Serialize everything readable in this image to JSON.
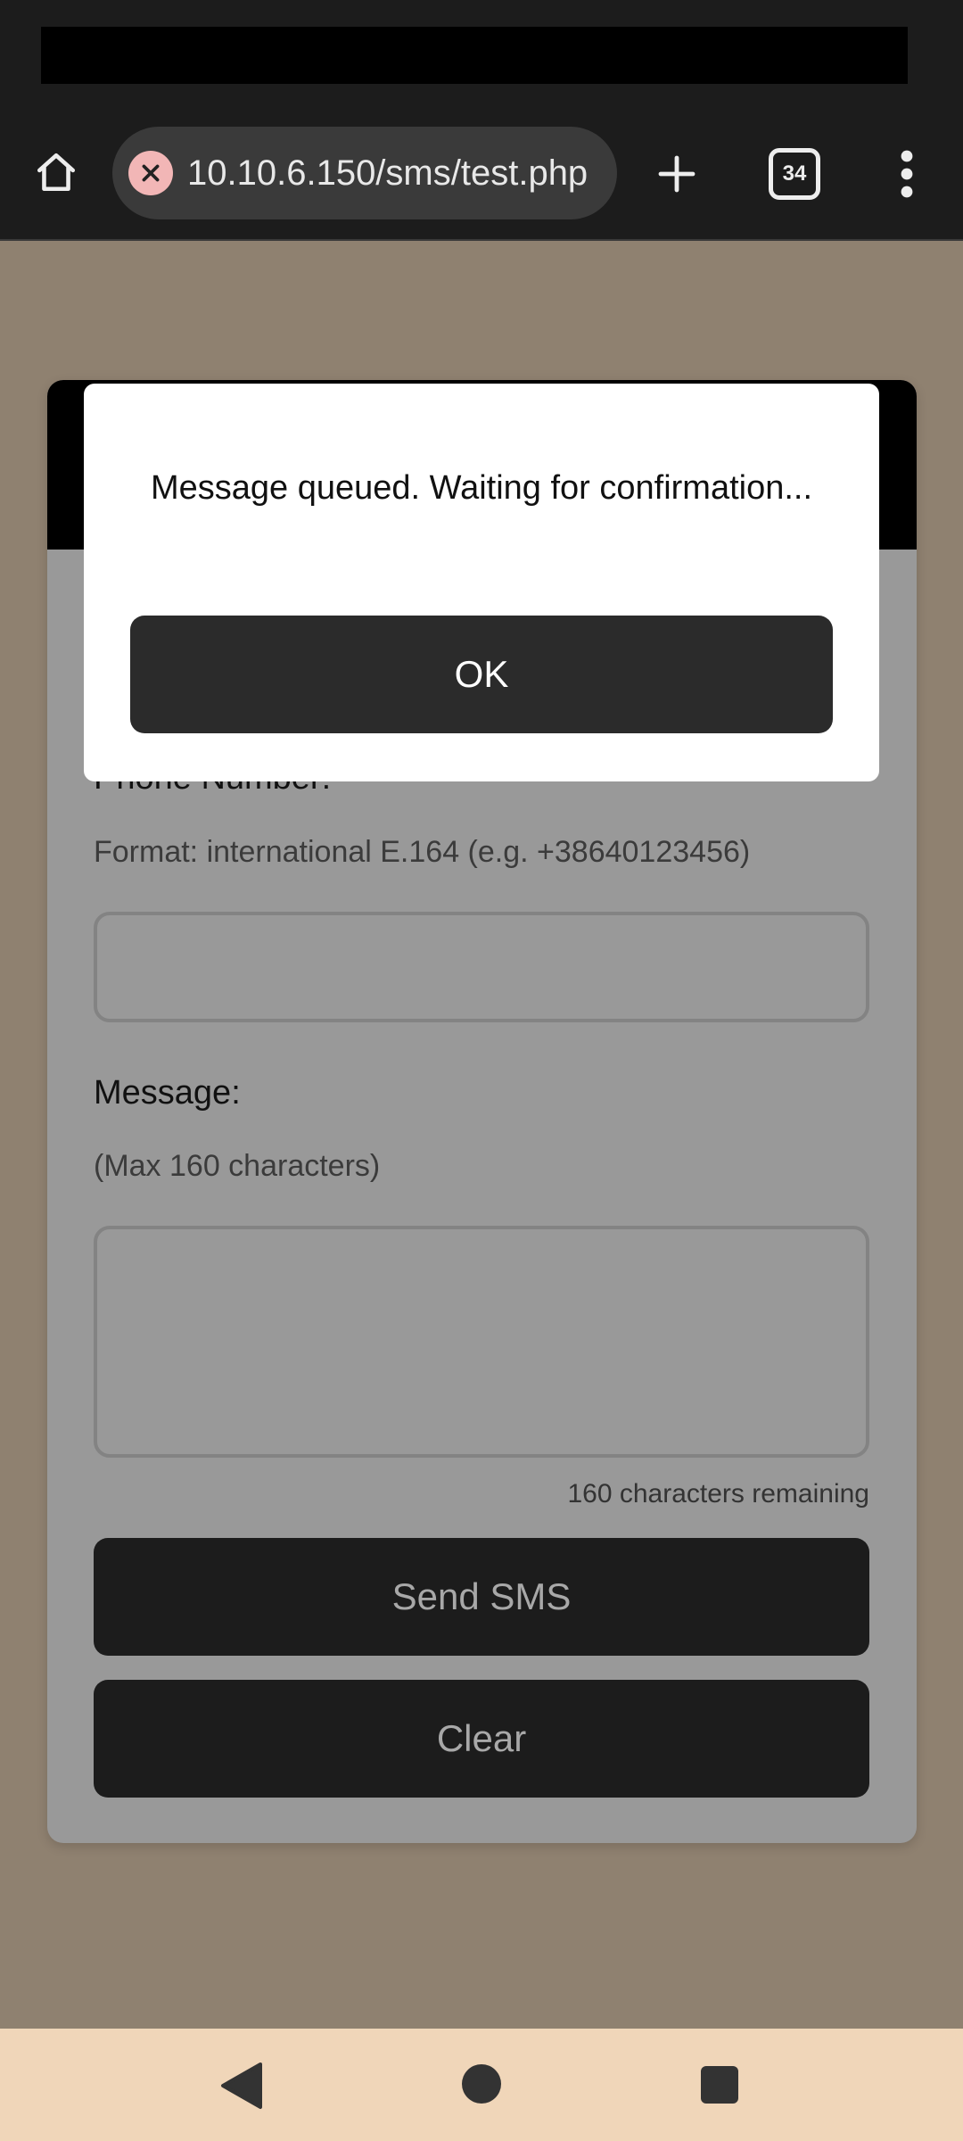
{
  "browser": {
    "url": "10.10.6.150/sms/test.php",
    "tab_count": "34",
    "icons": [
      "home-icon",
      "insecure-connection-icon",
      "plus-icon",
      "tab-switcher-icon",
      "more-vert-icon"
    ]
  },
  "form": {
    "phone_label": "Phone Number:",
    "phone_hint": "Format: international E.164 (e.g. +38640123456)",
    "phone_value": "",
    "message_label": "Message:",
    "message_hint": "(Max 160 characters)",
    "message_value": "",
    "remaining": "160 characters remaining",
    "send_label": "Send SMS",
    "clear_label": "Clear"
  },
  "dialog": {
    "message": "Message queued. Waiting for confirmation...",
    "ok_label": "OK"
  },
  "nav": {
    "icons": [
      "back-icon",
      "home-circle-icon",
      "recents-icon"
    ]
  },
  "colors": {
    "overlay_bg": "#8f8170",
    "toolbar_bg": "#1c1c1c",
    "button_bg": "#1c1c1c",
    "nav_bg": "#f0d6b9"
  }
}
